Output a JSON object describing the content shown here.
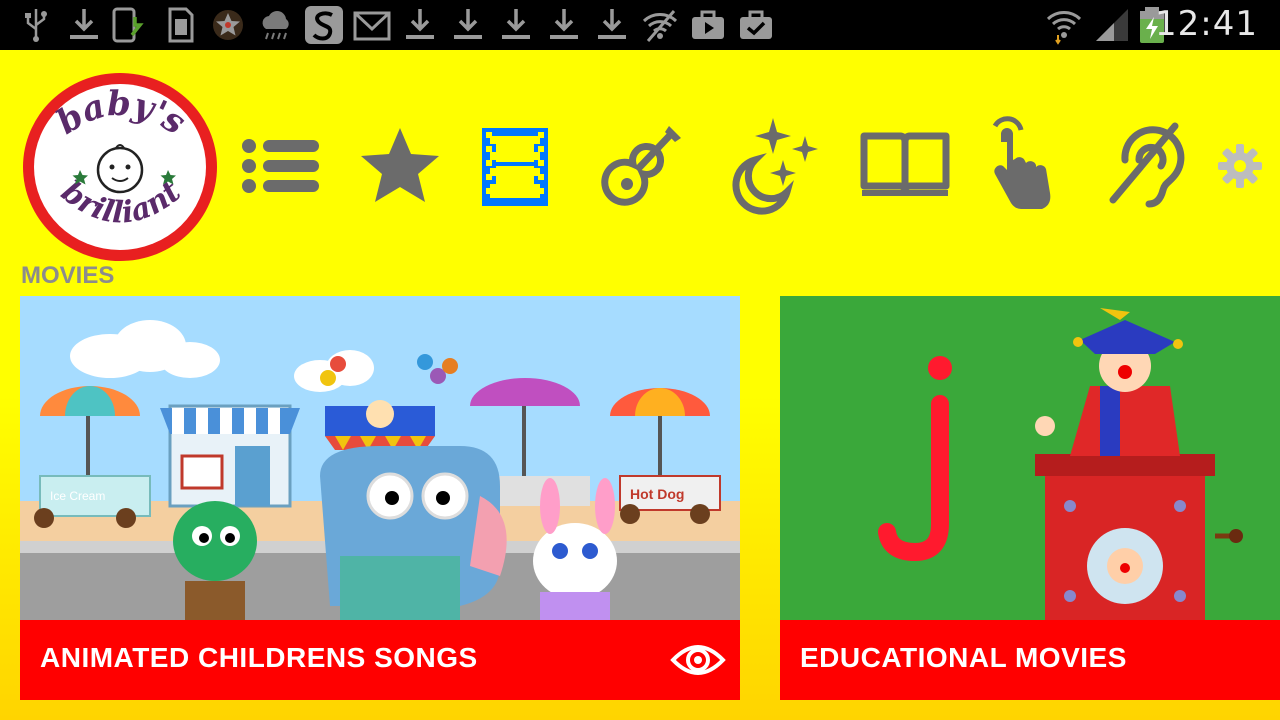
{
  "status_bar": {
    "time": "12:41",
    "left_icons": [
      "usb-icon",
      "download-icon",
      "phone-update-icon",
      "sd-card-icon",
      "star-badge-icon",
      "weather-icon",
      "swype-icon",
      "gmail-icon",
      "download-icon",
      "download-icon",
      "download-icon",
      "download-icon",
      "download-icon",
      "wifi-off-icon",
      "briefcase-play-icon",
      "briefcase-check-icon"
    ],
    "right_icons": [
      "wifi-icon",
      "signal-icon",
      "battery-charging-icon"
    ]
  },
  "app": {
    "logo_text": "baby's brilliant",
    "nav": [
      {
        "name": "list",
        "icon": "list-icon",
        "selected": false
      },
      {
        "name": "favorites",
        "icon": "star-icon",
        "selected": false
      },
      {
        "name": "movies",
        "icon": "film-icon",
        "selected": true
      },
      {
        "name": "music",
        "icon": "guitar-icon",
        "selected": false
      },
      {
        "name": "night",
        "icon": "moon-stars-icon",
        "selected": false
      },
      {
        "name": "books",
        "icon": "book-icon",
        "selected": false
      },
      {
        "name": "touch",
        "icon": "touch-hand-icon",
        "selected": false
      },
      {
        "name": "hearing",
        "icon": "hearing-icon",
        "selected": false
      }
    ],
    "colors": {
      "background": "#ffff00",
      "accent": "#0077ff",
      "icon": "#6b6b6b",
      "caption": "#ff0000"
    }
  },
  "section": {
    "title": "MOVIES"
  },
  "cards": [
    {
      "title": "ANIMATED CHILDRENS SONGS",
      "watched": true,
      "thumb_texts": [
        "Ice Cream",
        "Hot Dog"
      ]
    },
    {
      "title": "EDUCATIONAL MOVIES",
      "watched": false,
      "thumb_texts": []
    }
  ]
}
